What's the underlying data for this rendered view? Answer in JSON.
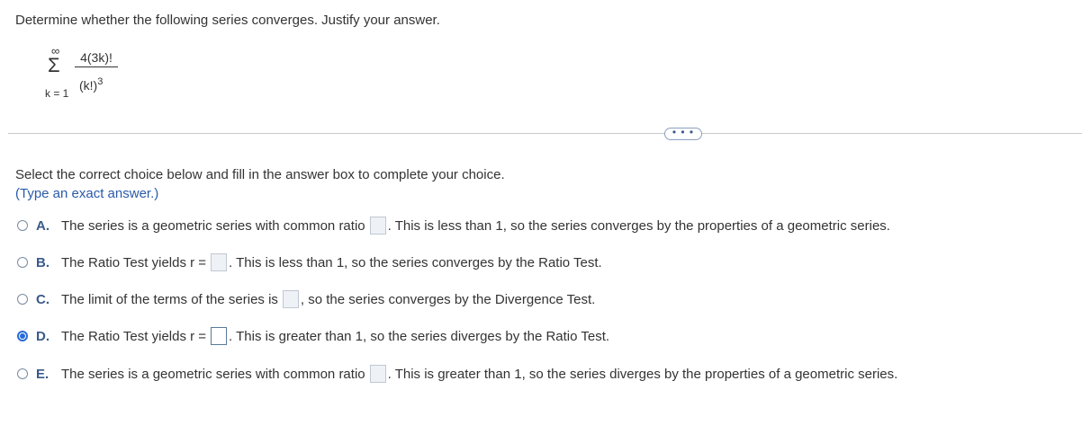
{
  "question": "Determine whether the following series converges. Justify your answer.",
  "series": {
    "upper_limit": "∞",
    "sigma": "Σ",
    "lower_limit": "k = 1",
    "numerator": "4(3k)!",
    "denominator": "(k!)",
    "denominator_power": "3"
  },
  "more_button": "• • •",
  "instruction": "Select the correct choice below and fill in the answer box to complete your choice.",
  "hint": "(Type an exact answer.)",
  "choices": [
    {
      "letter": "A.",
      "before": "The series is a geometric series with common ratio",
      "after": ". This is less than 1, so the series converges by the properties of a geometric series.",
      "selected": false
    },
    {
      "letter": "B.",
      "before": "The Ratio Test yields r =",
      "after": ". This is less than 1, so the series converges by the Ratio Test.",
      "selected": false
    },
    {
      "letter": "C.",
      "before": "The limit of the terms of the series is",
      "after": ", so the series converges by the Divergence Test.",
      "selected": false
    },
    {
      "letter": "D.",
      "before": "The Ratio Test yields r =",
      "after": ". This is greater than 1, so the series diverges by the Ratio Test.",
      "selected": true
    },
    {
      "letter": "E.",
      "before": "The series is a geometric series with common ratio",
      "after": ". This is greater than 1, so the series diverges by the properties of a geometric series.",
      "selected": false
    }
  ],
  "colors": {
    "accent": "#2a6ad8",
    "hint": "#2a5aa8",
    "letter": "#3a5a8a"
  }
}
